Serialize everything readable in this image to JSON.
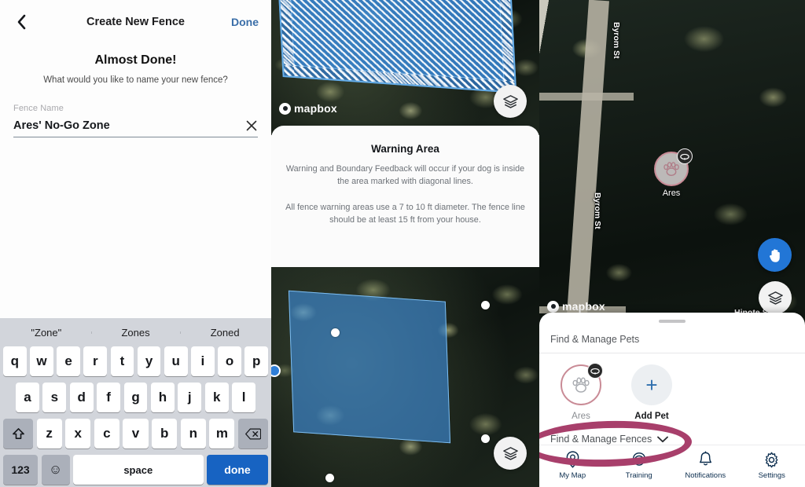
{
  "panel_create_fence": {
    "nav": {
      "back_icon": "chevron-left-icon",
      "title": "Create New Fence",
      "done_label": "Done",
      "done_color": "#3a6ea8"
    },
    "headline": "Almost Done!",
    "subhead": "What would you like to name your new fence?",
    "field": {
      "label": "Fence Name",
      "value": "Ares' No-Go Zone",
      "placeholder": "Fence Name",
      "clear_icon": "close-x-icon"
    },
    "keyboard": {
      "suggestions": [
        "\"Zone\"",
        "Zones",
        "Zoned"
      ],
      "row1": [
        "q",
        "w",
        "e",
        "r",
        "t",
        "y",
        "u",
        "i",
        "o",
        "p"
      ],
      "row2": [
        "a",
        "s",
        "d",
        "f",
        "g",
        "h",
        "j",
        "k",
        "l"
      ],
      "row3": [
        "z",
        "x",
        "c",
        "v",
        "b",
        "n",
        "m"
      ],
      "shift_icon": "shift-arrow-icon",
      "backspace_icon": "backspace-icon",
      "numbers_label": "123",
      "emoji_icon": "emoji-smiley-icon",
      "space_label": "space",
      "done_label": "done",
      "done_color": "#1763c2"
    }
  },
  "panel_warning": {
    "map_top": {
      "attribution": "mapbox",
      "layers_icon": "layers-stack-icon"
    },
    "card": {
      "title": "Warning Area",
      "paragraph1": "Warning and Boundary Feedback will occur if your dog is inside the area marked with diagonal lines.",
      "paragraph2": "All fence warning areas use a 7 to 10 ft diameter. The fence line should be at least 15 ft from your house."
    },
    "map_bottom": {
      "layers_icon": "layers-stack-icon",
      "fence_fill_color": "#3f8fde",
      "vertex_count": 4
    }
  },
  "panel_find_manage": {
    "map": {
      "attribution": "mapbox",
      "street_labels": [
        "Byrom St",
        "Byrom St",
        "Hinote St"
      ],
      "pet_marker": {
        "name": "Ares",
        "paw_icon": "paw-print-icon",
        "collar_icon": "collar-badge-icon",
        "ring_color": "#c98b96"
      },
      "pan_button_icon": "hand-pan-icon",
      "pan_button_color": "#2276d6",
      "layers_icon": "layers-stack-icon"
    },
    "sheet": {
      "grabber": "drag-handle",
      "title": "Find & Manage Pets",
      "pets": [
        {
          "name": "Ares",
          "paw_icon": "paw-print-icon",
          "collar_icon": "collar-badge-icon"
        }
      ],
      "add_pet": {
        "label": "Add Pet",
        "icon": "plus-icon"
      },
      "fences_row": {
        "label": "Find & Manage Fences",
        "chevron_icon": "chevron-down-icon"
      }
    },
    "tab_bar": [
      {
        "label": "My Map",
        "icon": "map-pin-icon"
      },
      {
        "label": "Training",
        "icon": "trainer-face-icon"
      },
      {
        "label": "Notifications",
        "icon": "bell-icon"
      },
      {
        "label": "Settings",
        "icon": "gear-icon"
      }
    ],
    "annotation": {
      "shape": "ellipse-highlight",
      "color": "#a83f6b"
    }
  }
}
